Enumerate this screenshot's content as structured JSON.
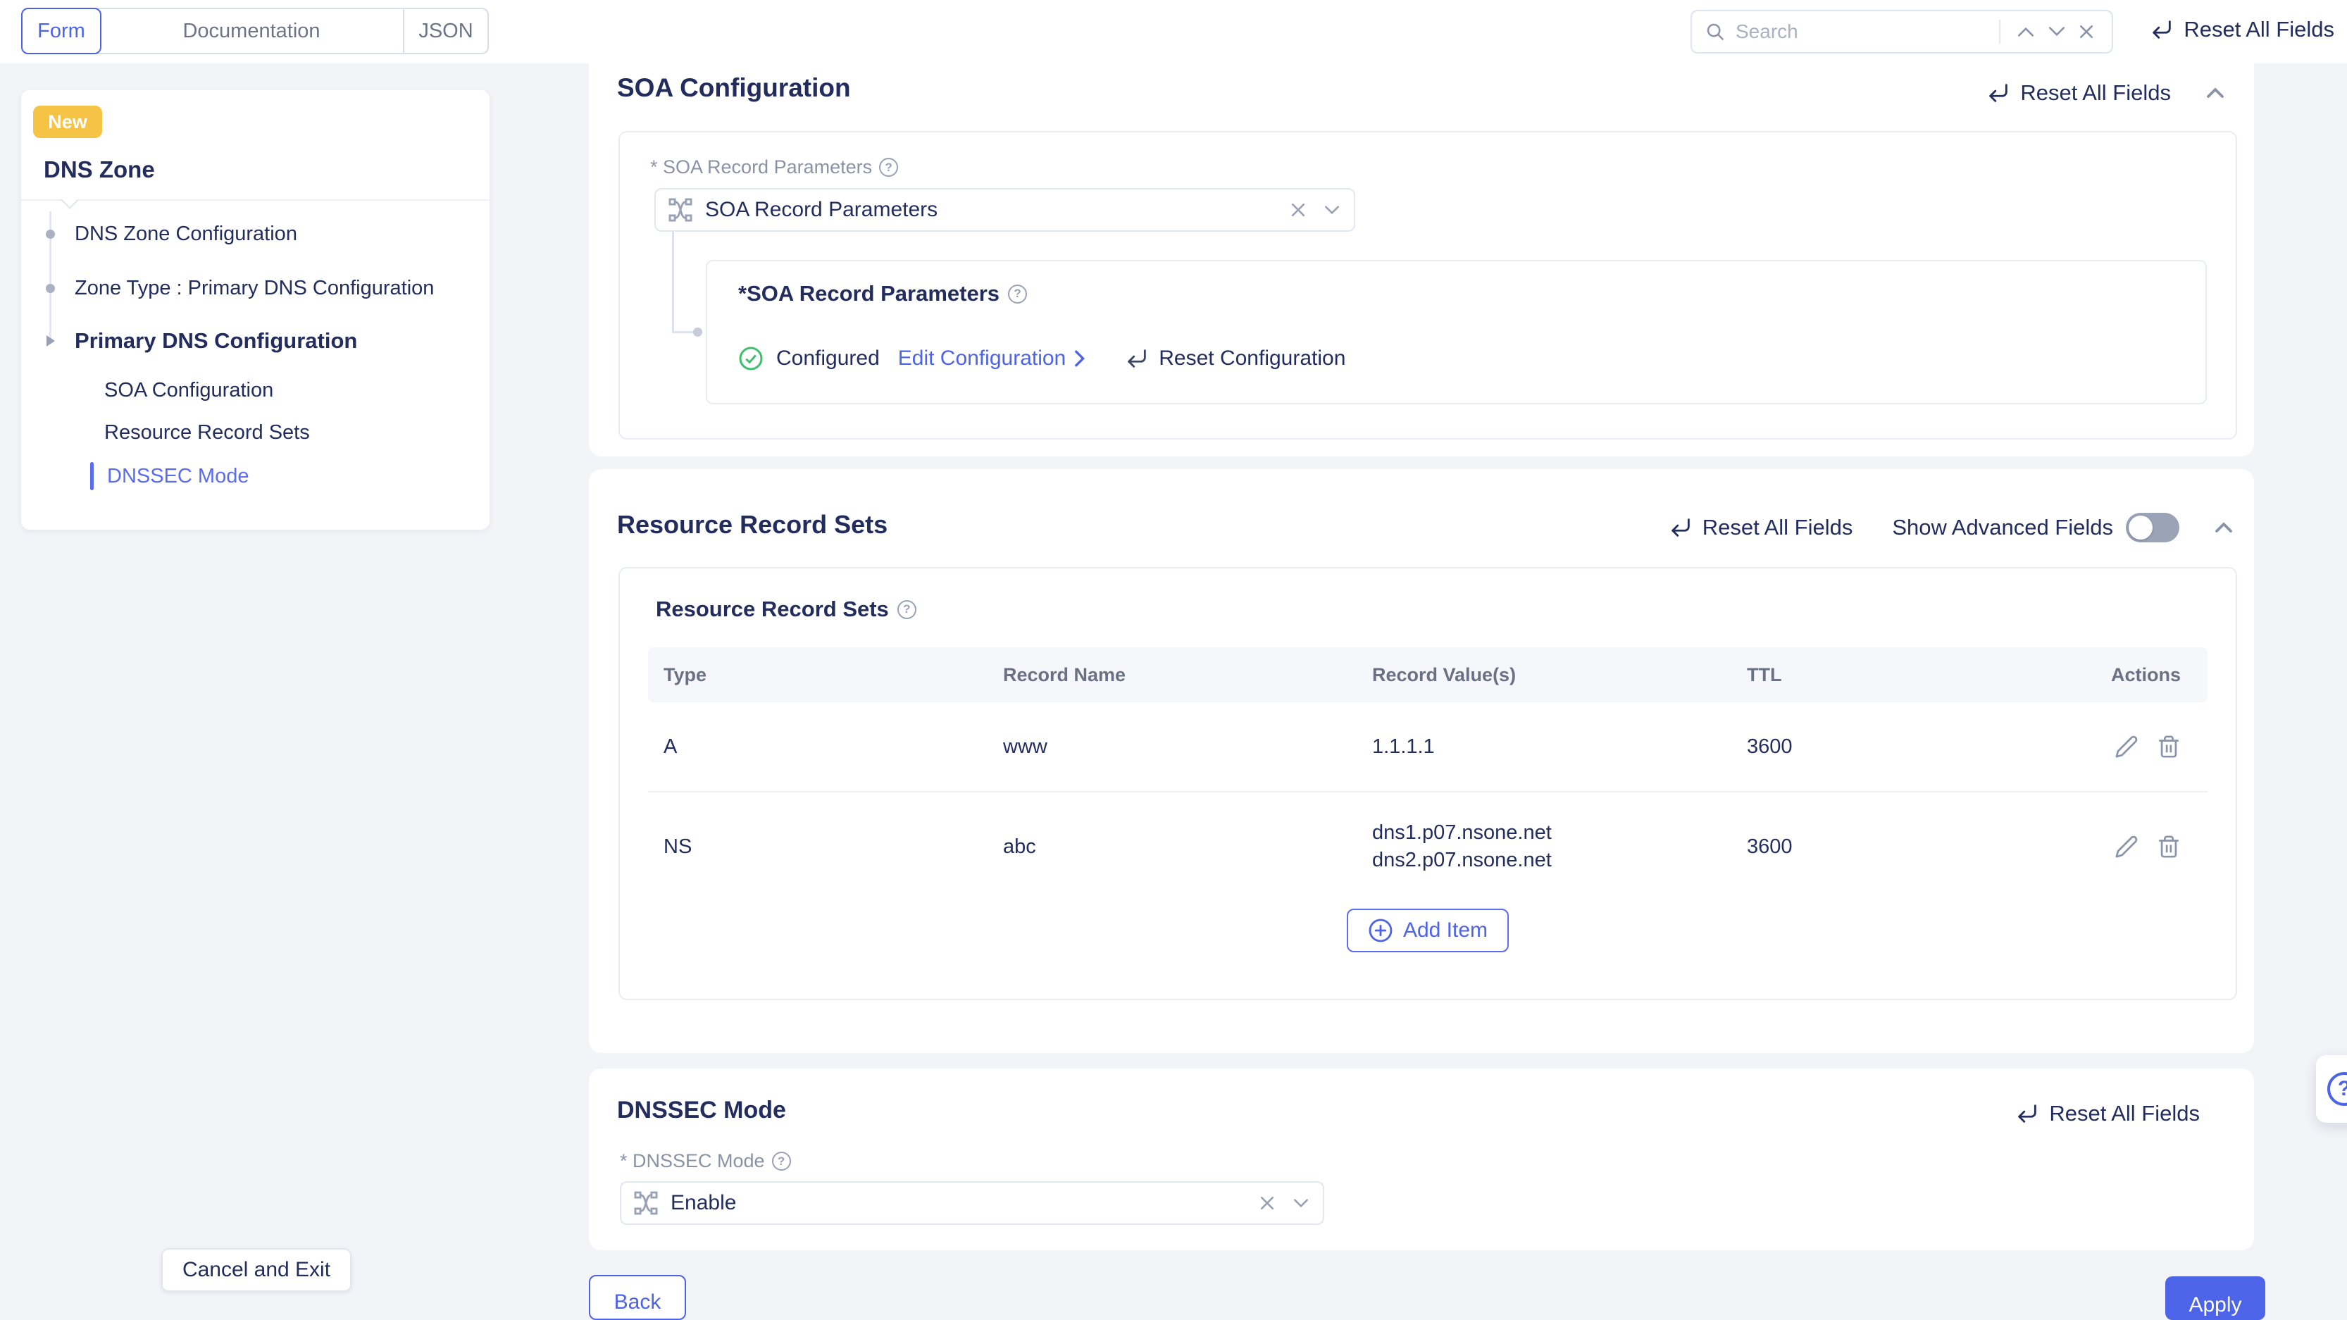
{
  "topbar": {
    "tabs": [
      {
        "label": "Form",
        "active": true
      },
      {
        "label": "Documentation",
        "active": false
      },
      {
        "label": "JSON",
        "active": false
      }
    ],
    "search_placeholder": "Search",
    "reset_all_label": "Reset All Fields"
  },
  "sidebar": {
    "badge": "New",
    "title": "DNS Zone",
    "items": [
      {
        "label": "DNS Zone Configuration"
      },
      {
        "label": "Zone Type : Primary DNS Configuration"
      },
      {
        "label": "Primary DNS Configuration"
      },
      {
        "label": "SOA Configuration"
      },
      {
        "label": "Resource Record Sets"
      },
      {
        "label": "DNSSEC Mode"
      }
    ],
    "active_item": "DNSSEC Mode"
  },
  "sections": {
    "soa": {
      "title": "SOA Configuration",
      "reset_all_label": "Reset All Fields",
      "param_label": "* SOA Record Parameters",
      "dropdown_value": "SOA Record Parameters",
      "subcard_title": "*SOA Record Parameters",
      "status": "Configured",
      "edit_link": "Edit Configuration",
      "reset_config_label": "Reset Configuration"
    },
    "rrs": {
      "title": "Resource Record Sets",
      "reset_all_label": "Reset All Fields",
      "advanced_label": "Show Advanced Fields",
      "advanced_toggle_on": false,
      "card_title": "Resource Record Sets",
      "table": {
        "headers": [
          "Type",
          "Record Name",
          "Record Value(s)",
          "TTL",
          "Actions"
        ],
        "rows": [
          {
            "type": "A",
            "name": "www",
            "values": [
              "1.1.1.1"
            ],
            "ttl": "3600"
          },
          {
            "type": "NS",
            "name": "abc",
            "values": [
              "dns1.p07.nsone.net",
              "dns2.p07.nsone.net"
            ],
            "ttl": "3600"
          }
        ]
      },
      "add_item_label": "Add Item"
    },
    "dnssec": {
      "title": "DNSSEC Mode",
      "reset_all_label": "Reset All Fields",
      "field_label": "* DNSSEC Mode",
      "dropdown_value": "Enable"
    }
  },
  "footer": {
    "cancel_label": "Cancel and Exit",
    "back_label": "Back",
    "apply_label": "Apply"
  },
  "colors": {
    "accent_blue": "#4d63e8",
    "navy_text": "#232d5d",
    "badge_yellow": "#f6c445",
    "success_green": "#3fbf6e",
    "page_background": "#f3f4f8",
    "border_gray": "#e9ecf4"
  }
}
